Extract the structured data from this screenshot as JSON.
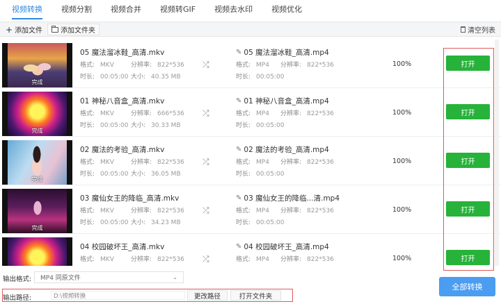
{
  "tabs": [
    {
      "label": "视频转换"
    },
    {
      "label": "视频分割"
    },
    {
      "label": "视频合并"
    },
    {
      "label": "视频转GIF"
    },
    {
      "label": "视频去水印"
    },
    {
      "label": "视频优化"
    }
  ],
  "toolbar": {
    "add_file": "添加文件",
    "add_folder": "添加文件夹",
    "clear_list": "清空列表"
  },
  "labels": {
    "format": "格式:",
    "duration": "时长:",
    "resolution": "分辨率:",
    "size": "大小:",
    "done": "完成",
    "open": "打开"
  },
  "files": [
    {
      "src_name": "05 魔法溜冰鞋_高清.mkv",
      "dst_name": "05 魔法溜冰鞋_高清.mp4",
      "src_format": "MKV",
      "src_resolution": "822*536",
      "src_duration": "00:05:00",
      "src_size": "40.35 MB",
      "dst_format": "MP4",
      "dst_resolution": "822*536",
      "dst_duration": "00:05:00",
      "progress": "100%"
    },
    {
      "src_name": "01 神秘八音盒_高清.mkv",
      "dst_name": "01 神秘八音盒_高清.mp4",
      "src_format": "MKV",
      "src_resolution": "666*536",
      "src_duration": "00:05:00",
      "src_size": "30.33 MB",
      "dst_format": "MP4",
      "dst_resolution": "822*536",
      "dst_duration": "00:05:00",
      "progress": "100%"
    },
    {
      "src_name": "02 魔法的考验_高清.mkv",
      "dst_name": "02 魔法的考验_高清.mp4",
      "src_format": "MKV",
      "src_resolution": "822*536",
      "src_duration": "00:05:00",
      "src_size": "36.05 MB",
      "dst_format": "MP4",
      "dst_resolution": "822*536",
      "dst_duration": "00:05:00",
      "progress": "100%"
    },
    {
      "src_name": "03 魔仙女王的降临_高清.mkv",
      "dst_name": "03 魔仙女王的降临...清.mp4",
      "src_format": "MKV",
      "src_resolution": "822*536",
      "src_duration": "00:05:00",
      "src_size": "34.23 MB",
      "dst_format": "MP4",
      "dst_resolution": "822*536",
      "dst_duration": "00:05:00",
      "progress": "100%"
    },
    {
      "src_name": "04 校园破坏王_高清.mkv",
      "dst_name": "04 校园破坏王_高清.mp4",
      "src_format": "MKV",
      "src_resolution": "822*536",
      "src_duration": "",
      "src_size": "",
      "dst_format": "MP4",
      "dst_resolution": "822*536",
      "dst_duration": "",
      "progress": "100%"
    }
  ],
  "bottom": {
    "format_label": "输出格式:",
    "format_value": "MP4  同原文件",
    "path_label": "输出路径:",
    "path_value": "D:\\视频转换",
    "change_path": "更改路径",
    "open_folder": "打开文件夹",
    "convert_all": "全部转换"
  },
  "colors": {
    "accent": "#2f87e0",
    "open_button": "#27b23a",
    "convert_all": "#4a9df0",
    "highlight_border": "#e05a5a"
  }
}
